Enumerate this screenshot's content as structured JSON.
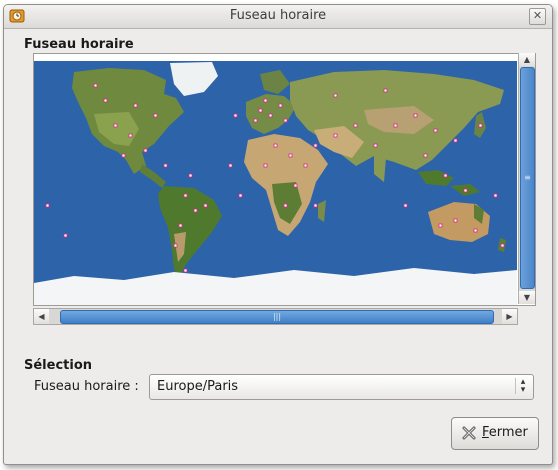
{
  "window": {
    "title": "Fuseau horaire"
  },
  "map_section": {
    "title": "Fuseau horaire"
  },
  "selection": {
    "title": "Sélection",
    "timezone_label": "Fuseau horaire :",
    "timezone_value": "Europe/Paris"
  },
  "buttons": {
    "close_mnemonic": "F",
    "close_rest": "ermer"
  },
  "colors": {
    "ocean": "#2d63a8",
    "selection_blue": "#4a86cb",
    "marker": "#d52a7c"
  },
  "icons": [
    "app-icon",
    "close-window-icon",
    "scroll-up-icon",
    "scroll-down-icon",
    "scroll-left-icon",
    "scroll-right-icon",
    "combo-arrows-icon",
    "close-x-icon"
  ]
}
